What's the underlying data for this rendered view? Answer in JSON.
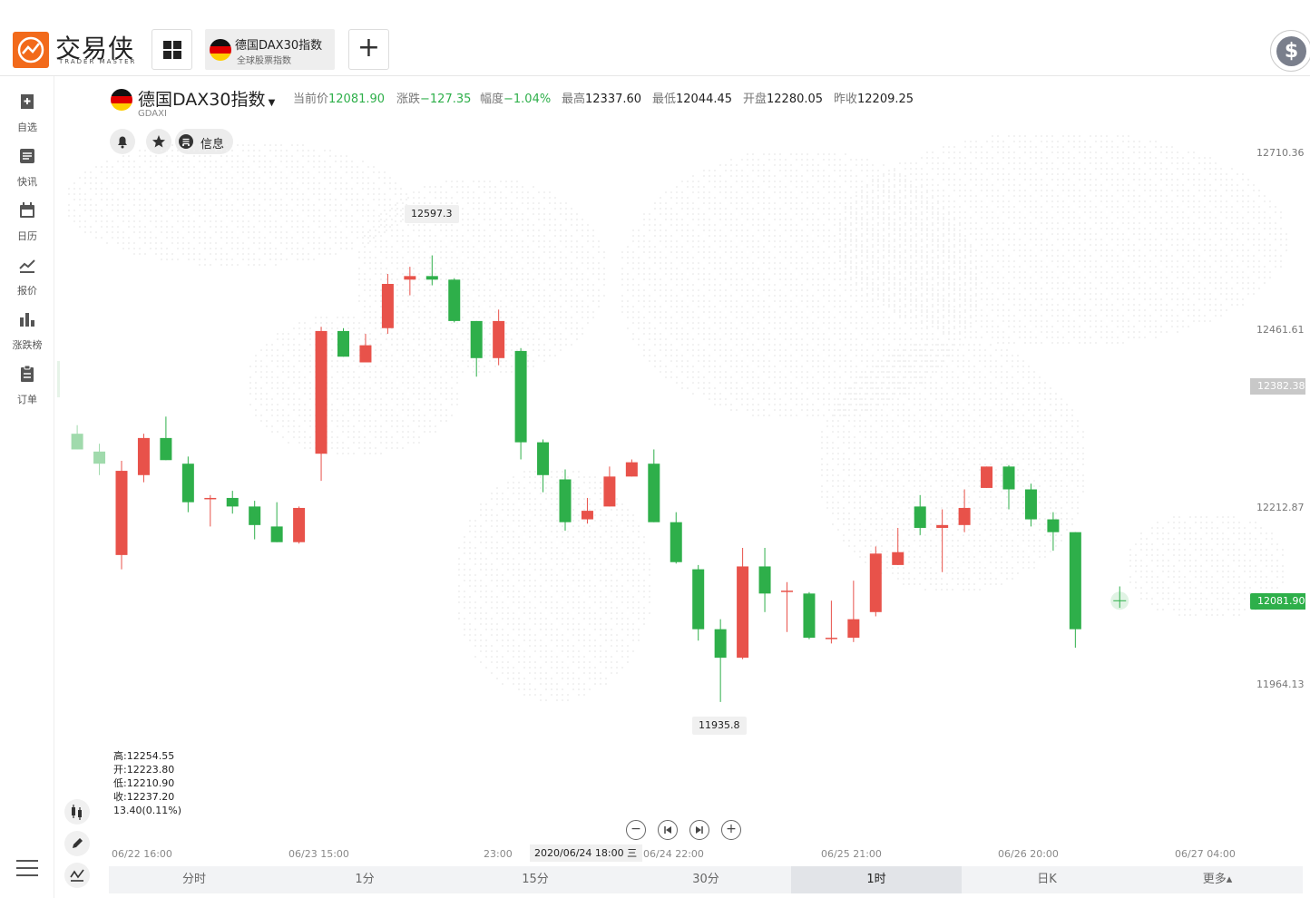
{
  "header": {
    "logo_cn": "交易侠",
    "logo_en": "TRADER MASTER",
    "tab": {
      "title": "德国DAX30指数",
      "subtitle": "全球股票指数"
    },
    "add_label": "+",
    "currency_symbol": "$"
  },
  "sidebar": {
    "items": [
      {
        "label": "自选",
        "icon": "bookmark-add-icon"
      },
      {
        "label": "快讯",
        "icon": "news-icon"
      },
      {
        "label": "日历",
        "icon": "calendar-icon"
      },
      {
        "label": "报价",
        "icon": "trend-line-icon"
      },
      {
        "label": "涨跌榜",
        "icon": "bar-chart-icon"
      },
      {
        "label": "订单",
        "icon": "clipboard-icon"
      }
    ]
  },
  "instrument": {
    "name": "德国DAX30指数",
    "code": "GDAXI",
    "quote": [
      {
        "key": "当前价",
        "value": "12081.90",
        "color": "green"
      },
      {
        "key": "涨跌",
        "value": "−127.35",
        "color": "green"
      },
      {
        "key": "幅度",
        "value": "−1.04%",
        "color": "green"
      },
      {
        "key": "最高",
        "value": "12337.60",
        "color": "dark"
      },
      {
        "key": "最低",
        "value": "12044.45",
        "color": "dark"
      },
      {
        "key": "开盘",
        "value": "12280.05",
        "color": "dark"
      },
      {
        "key": "昨收",
        "value": "12209.25",
        "color": "dark"
      }
    ],
    "info_label": "信息"
  },
  "chart_data": {
    "type": "candlestick",
    "y_ticks": [
      "12710.36",
      "12461.61",
      "12212.87",
      "11964.13"
    ],
    "crosshair_price": "12382.38",
    "last_price": "12081.90",
    "x_ticks": [
      "06/22 16:00",
      "06/23 15:00",
      "23:00",
      "06/24 22:00",
      "06/25 21:00",
      "06/26 20:00",
      "06/27 04:00"
    ],
    "x_cursor_label": "2020/06/24 18:00 三",
    "max_label": "12597.3",
    "min_label": "11935.8",
    "ohlc_readout": [
      "高:12254.55",
      "开:12223.80",
      "低:12210.90",
      "收:12237.20",
      "13.40(0.11%)"
    ],
    "up_color": "#e8524a",
    "down_color": "#2eaf4a",
    "candles": [
      {
        "o": 12316,
        "c": 12294,
        "h": 12328,
        "l": 12294
      },
      {
        "o": 12291,
        "c": 12274,
        "h": 12302,
        "l": 12258
      },
      {
        "o": 12146,
        "c": 12264,
        "h": 12278,
        "l": 12126
      },
      {
        "o": 12258,
        "c": 12310,
        "h": 12316,
        "l": 12248
      },
      {
        "o": 12310,
        "c": 12279,
        "h": 12340,
        "l": 12279
      },
      {
        "o": 12274,
        "c": 12220,
        "h": 12284,
        "l": 12206
      },
      {
        "o": 12226,
        "c": 12226,
        "h": 12230,
        "l": 12186
      },
      {
        "o": 12226,
        "c": 12214,
        "h": 12236,
        "l": 12204
      },
      {
        "o": 12214,
        "c": 12188,
        "h": 12222,
        "l": 12168
      },
      {
        "o": 12186,
        "c": 12164,
        "h": 12220,
        "l": 12164
      },
      {
        "o": 12164,
        "c": 12212,
        "h": 12214,
        "l": 12162
      },
      {
        "o": 12288,
        "c": 12460,
        "h": 12466,
        "l": 12250
      },
      {
        "o": 12460,
        "c": 12424,
        "h": 12464,
        "l": 12424
      },
      {
        "o": 12416,
        "c": 12440,
        "h": 12456,
        "l": 12416
      },
      {
        "o": 12464,
        "c": 12526,
        "h": 12540,
        "l": 12456
      },
      {
        "o": 12532,
        "c": 12537,
        "h": 12550,
        "l": 12510
      },
      {
        "o": 12537,
        "c": 12532,
        "h": 12566,
        "l": 12524
      },
      {
        "o": 12532,
        "c": 12474,
        "h": 12534,
        "l": 12472
      },
      {
        "o": 12474,
        "c": 12422,
        "h": 12474,
        "l": 12396
      },
      {
        "o": 12422,
        "c": 12474,
        "h": 12490,
        "l": 12412
      },
      {
        "o": 12432,
        "c": 12304,
        "h": 12436,
        "l": 12280
      },
      {
        "o": 12304,
        "c": 12258,
        "h": 12308,
        "l": 12234
      },
      {
        "o": 12252,
        "c": 12192,
        "h": 12266,
        "l": 12180
      },
      {
        "o": 12196,
        "c": 12208,
        "h": 12226,
        "l": 12190
      },
      {
        "o": 12214,
        "c": 12256,
        "h": 12270,
        "l": 12214
      },
      {
        "o": 12256,
        "c": 12276,
        "h": 12280,
        "l": 12256
      },
      {
        "o": 12274,
        "c": 12192,
        "h": 12294,
        "l": 12192
      },
      {
        "o": 12192,
        "c": 12136,
        "h": 12206,
        "l": 12134
      },
      {
        "o": 12126,
        "c": 12042,
        "h": 12132,
        "l": 12026
      },
      {
        "o": 12042,
        "c": 12002,
        "h": 12056,
        "l": 11940
      },
      {
        "o": 12002,
        "c": 12130,
        "h": 12156,
        "l": 12000
      },
      {
        "o": 12130,
        "c": 12092,
        "h": 12156,
        "l": 12066
      },
      {
        "o": 12096,
        "c": 12096,
        "h": 12108,
        "l": 12038
      },
      {
        "o": 12092,
        "c": 12030,
        "h": 12094,
        "l": 12028
      },
      {
        "o": 12030,
        "c": 12030,
        "h": 12082,
        "l": 12022
      },
      {
        "o": 12030,
        "c": 12056,
        "h": 12110,
        "l": 12024
      },
      {
        "o": 12066,
        "c": 12148,
        "h": 12158,
        "l": 12060
      },
      {
        "o": 12132,
        "c": 12150,
        "h": 12184,
        "l": 12132
      },
      {
        "o": 12214,
        "c": 12184,
        "h": 12230,
        "l": 12174
      },
      {
        "o": 12184,
        "c": 12188,
        "h": 12210,
        "l": 12122
      },
      {
        "o": 12188,
        "c": 12212,
        "h": 12238,
        "l": 12178
      },
      {
        "o": 12240,
        "c": 12270,
        "h": 12270,
        "l": 12240
      },
      {
        "o": 12270,
        "c": 12238,
        "h": 12272,
        "l": 12210
      },
      {
        "o": 12238,
        "c": 12196,
        "h": 12246,
        "l": 12186
      },
      {
        "o": 12196,
        "c": 12178,
        "h": 12206,
        "l": 12152
      },
      {
        "o": 12178,
        "c": 12042,
        "h": 12178,
        "l": 12016
      }
    ],
    "last_live": {
      "o": 12082,
      "c": 12081.9,
      "h": 12102,
      "l": 12072
    }
  },
  "timeframes": {
    "items": [
      "分时",
      "1分",
      "15分",
      "30分",
      "1时",
      "日K",
      "更多▴"
    ],
    "active": "1时"
  }
}
